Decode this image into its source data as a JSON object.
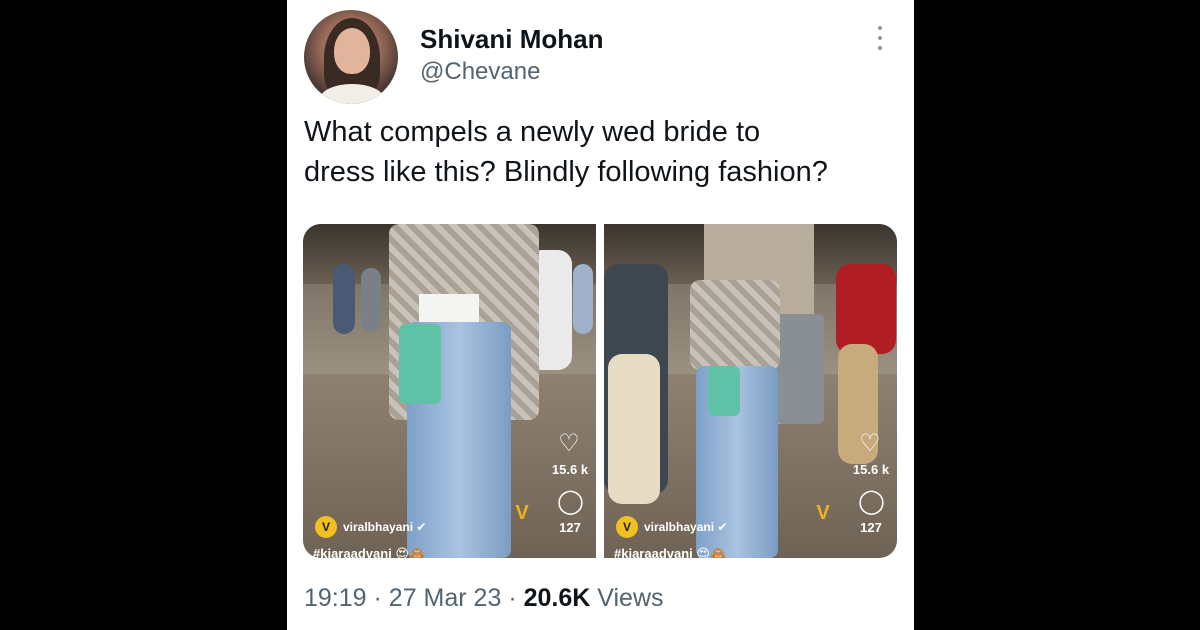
{
  "tweet": {
    "display_name": "Shivani Mohan",
    "handle": "@Chevane",
    "text_line1": "What compels a newly wed bride to",
    "text_line2": "dress like this? Blindly following fashion?",
    "time": "19:19",
    "separator": "·",
    "date": "27 Mar 23",
    "views_count": "20.6K",
    "views_label": "Views"
  },
  "media": [
    {
      "likes_count": "15.6 k",
      "comments_count": "127",
      "channel_name": "viralbhayani",
      "hashtag": "#kiaraadvani 😍🙈"
    },
    {
      "likes_count": "15.6 k",
      "comments_count": "127",
      "channel_name": "viralbhayani",
      "hashtag": "#kiaraadvani 😍🙈"
    }
  ],
  "icons": {
    "more": "more-options-icon",
    "heart": "heart-icon",
    "comment": "comment-icon",
    "verified": "verified-icon"
  },
  "colors": {
    "text_primary": "#0f1419",
    "text_secondary": "#536471",
    "background": "#ffffff",
    "badge": "#f0c020"
  }
}
